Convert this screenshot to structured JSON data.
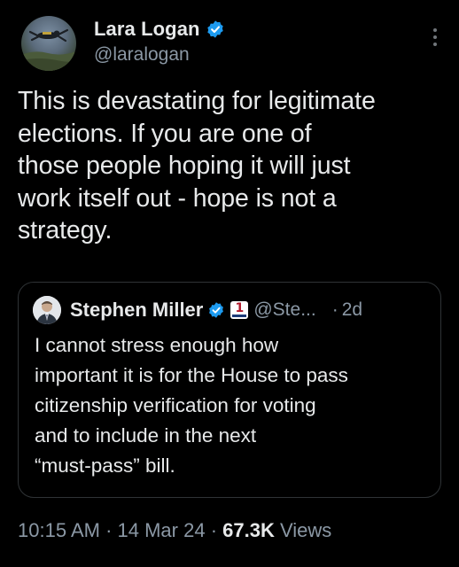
{
  "author": {
    "display_name": "Lara Logan",
    "handle": "@laralogan",
    "verified": true,
    "avatar_icon": "skydiver-avatar"
  },
  "tweet": {
    "text": "This is devastating for legitimate\nelections. If you are one of\nthose people hoping it will just\nwork itself out - hope is not a\nstrategy."
  },
  "quoted_tweet": {
    "display_name": "Stephen Miller",
    "handle": "@Ste...",
    "verified": true,
    "separator": "·",
    "time_ago": "2d",
    "text": "I cannot stress enough how\nimportant it is for the House to pass\ncitizenship verification for voting\nand to include in the next\n“must-pass” bill.",
    "affiliate_badge_text": "1"
  },
  "meta": {
    "time": "10:15 AM",
    "separator": " · ",
    "date": "14 Mar 24",
    "views_count": "67.3K",
    "views_label": " Views"
  },
  "colors": {
    "background": "#000000",
    "text": "#e7e9ea",
    "secondary": "#8b98a5",
    "verified_blue": "#1d9bf0",
    "border": "#2f3336"
  },
  "icons": {
    "more": "more-options-icon",
    "verified": "verified-badge-icon"
  }
}
